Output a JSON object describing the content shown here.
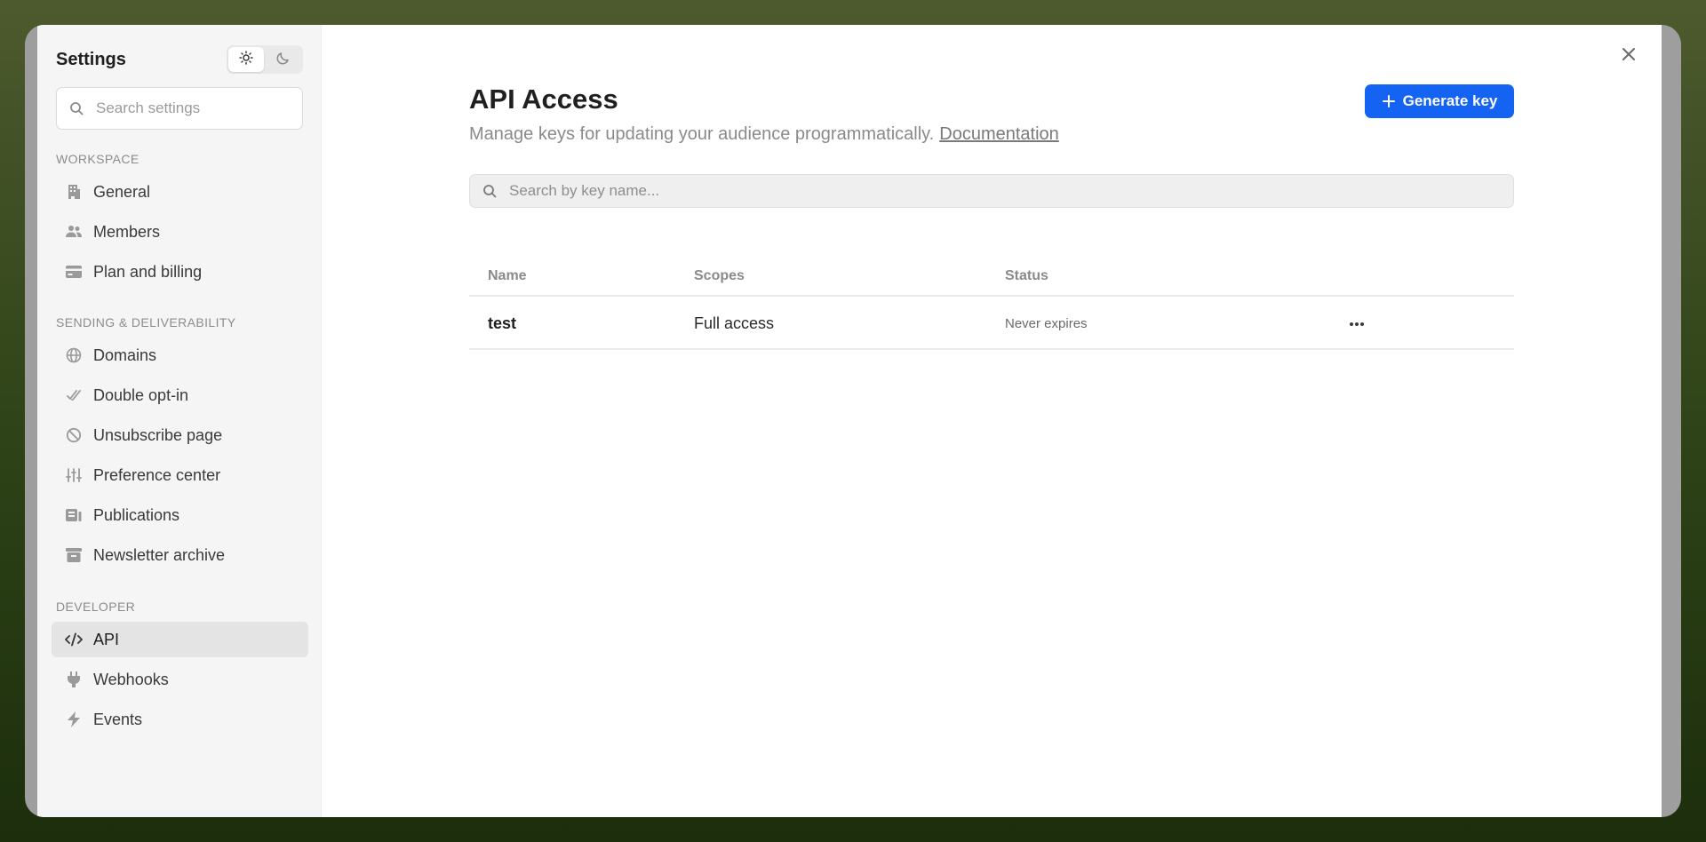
{
  "sidebar": {
    "title": "Settings",
    "search_placeholder": "Search settings",
    "sections": [
      {
        "label": "WORKSPACE",
        "items": [
          {
            "label": "General",
            "icon": "building-icon"
          },
          {
            "label": "Members",
            "icon": "users-icon"
          },
          {
            "label": "Plan and billing",
            "icon": "credit-card-icon"
          }
        ]
      },
      {
        "label": "SENDING & DELIVERABILITY",
        "items": [
          {
            "label": "Domains",
            "icon": "globe-icon"
          },
          {
            "label": "Double opt-in",
            "icon": "double-check-icon"
          },
          {
            "label": "Unsubscribe page",
            "icon": "ban-icon"
          },
          {
            "label": "Preference center",
            "icon": "sliders-icon"
          },
          {
            "label": "Publications",
            "icon": "publication-icon"
          },
          {
            "label": "Newsletter archive",
            "icon": "archive-icon"
          }
        ]
      },
      {
        "label": "DEVELOPER",
        "items": [
          {
            "label": "API",
            "icon": "code-icon",
            "active": true
          },
          {
            "label": "Webhooks",
            "icon": "plug-icon"
          },
          {
            "label": "Events",
            "icon": "bolt-icon"
          }
        ]
      }
    ]
  },
  "main": {
    "title": "API Access",
    "subtitle": "Manage keys for updating your audience programmatically.",
    "doc_link": "Documentation",
    "generate_label": "Generate key",
    "search_placeholder": "Search by key name...",
    "table": {
      "columns": [
        "Name",
        "Scopes",
        "Status"
      ],
      "rows": [
        {
          "name": "test",
          "scopes": "Full access",
          "status": "Never expires"
        }
      ]
    }
  },
  "colors": {
    "accent": "#1463f3",
    "sidebar_bg": "#f5f5f5"
  }
}
